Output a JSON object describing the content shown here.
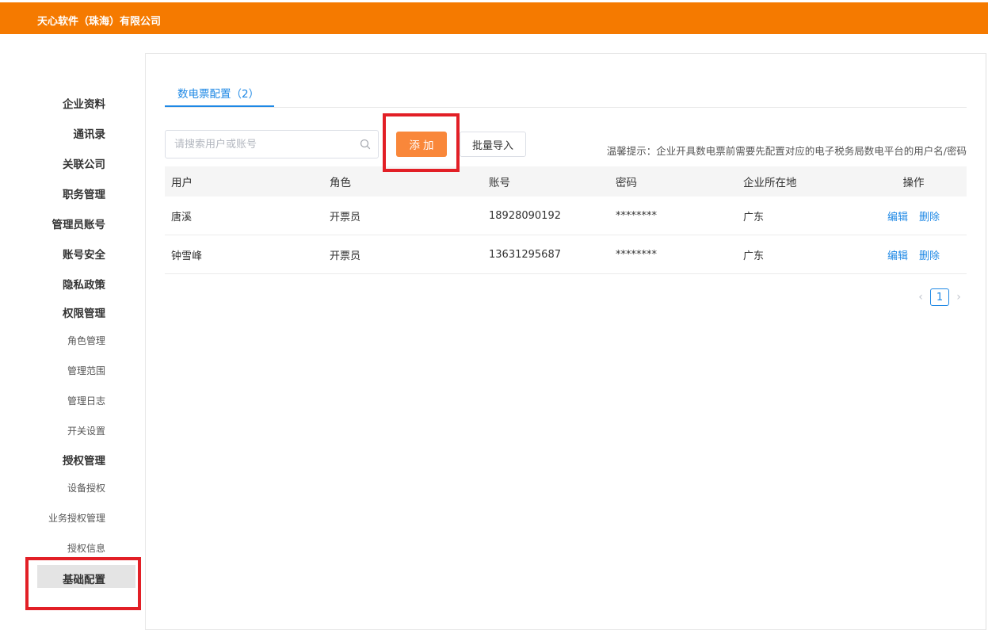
{
  "header": {
    "company_name": "天心软件（珠海）有限公司",
    "bg_color": "#f57a00"
  },
  "sidebar": {
    "items": [
      {
        "label": "企业资料",
        "level": "main"
      },
      {
        "label": "通讯录",
        "level": "main"
      },
      {
        "label": "关联公司",
        "level": "main"
      },
      {
        "label": "职务管理",
        "level": "main"
      },
      {
        "label": "管理员账号",
        "level": "main"
      },
      {
        "label": "账号安全",
        "level": "main"
      },
      {
        "label": "隐私政策",
        "level": "main"
      },
      {
        "label": "权限管理",
        "level": "main"
      },
      {
        "label": "角色管理",
        "level": "sub"
      },
      {
        "label": "管理范围",
        "level": "sub"
      },
      {
        "label": "管理日志",
        "level": "sub"
      },
      {
        "label": "开关设置",
        "level": "sub"
      },
      {
        "label": "授权管理",
        "level": "main"
      },
      {
        "label": "设备授权",
        "level": "sub"
      },
      {
        "label": "业务授权管理",
        "level": "sub"
      },
      {
        "label": "授权信息",
        "level": "sub"
      },
      {
        "label": "基础配置",
        "level": "main",
        "active": true
      }
    ]
  },
  "main": {
    "tab_label": "数电票配置（2）",
    "search_placeholder": "请搜索用户或账号",
    "add_button": "添加",
    "import_button": "批量导入",
    "tip": "温馨提示：企业开具数电票前需要先配置对应的电子税务局数电平台的用户名/密码",
    "table": {
      "headers": [
        "用户",
        "角色",
        "账号",
        "密码",
        "企业所在地",
        "操作"
      ],
      "rows": [
        {
          "user": "唐溪",
          "role": "开票员",
          "account": "18928090192",
          "password": "********",
          "location": "广东",
          "edit": "编辑",
          "delete": "删除"
        },
        {
          "user": "钟雪峰",
          "role": "开票员",
          "account": "13631295687",
          "password": "********",
          "location": "广东",
          "edit": "编辑",
          "delete": "删除"
        }
      ]
    },
    "pagination": {
      "current_page": "1",
      "prev_icon": "chevron-left-icon",
      "next_icon": "chevron-right-icon"
    }
  },
  "colors": {
    "accent_blue": "#1e88e5",
    "add_orange": "#f9873a",
    "highlight_red": "#e21f26"
  }
}
